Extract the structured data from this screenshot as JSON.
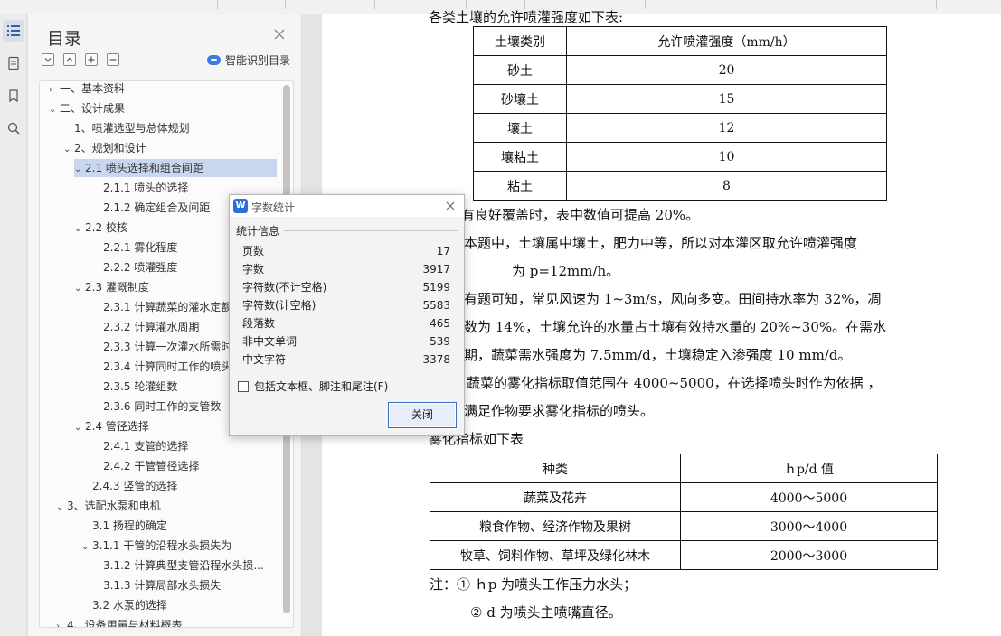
{
  "sidebar": {
    "title": "目录",
    "ai_toc_label": "智能识别目录",
    "items": [
      {
        "label": "一、基本资料",
        "arrow": "›"
      },
      {
        "label": "二、设计成果",
        "arrow": "⌄"
      },
      {
        "label": "1、喷灌选型与总体规划",
        "arrow": ""
      },
      {
        "label": "2、规划和设计",
        "arrow": "⌄"
      },
      {
        "label": "2.1 喷头选择和组合间距",
        "arrow": "⌄"
      },
      {
        "label": "2.1.1 喷头的选择",
        "arrow": ""
      },
      {
        "label": "2.1.2 确定组合及间距",
        "arrow": ""
      },
      {
        "label": "2.2 校核",
        "arrow": "⌄"
      },
      {
        "label": "2.2.1 雾化程度",
        "arrow": ""
      },
      {
        "label": "2.2.2 喷灌强度",
        "arrow": ""
      },
      {
        "label": "2.3 灌溉制度",
        "arrow": "⌄"
      },
      {
        "label": "2.3.1 计算蔬菜的灌水定额",
        "arrow": ""
      },
      {
        "label": "2.3.2 计算灌水周期",
        "arrow": ""
      },
      {
        "label": "2.3.3 计算一次灌水所需时",
        "arrow": ""
      },
      {
        "label": "2.3.4 计算同时工作的喷头",
        "arrow": ""
      },
      {
        "label": "2.3.5 轮灌组数",
        "arrow": ""
      },
      {
        "label": "2.3.6 同时工作的支管数",
        "arrow": ""
      },
      {
        "label": "2.4 管径选择",
        "arrow": "⌄"
      },
      {
        "label": "2.4.1 支管的选择",
        "arrow": ""
      },
      {
        "label": "2.4.2 干管管径选择",
        "arrow": ""
      },
      {
        "label": "2.4.3 竖管的选择",
        "arrow": ""
      },
      {
        "label": "3、选配水泵和电机",
        "arrow": "⌄"
      },
      {
        "label": "3.1 扬程的确定",
        "arrow": ""
      },
      {
        "label": "3.1.1 干管的沿程水头损失为",
        "arrow": "⌄"
      },
      {
        "label": "3.1.2 计算典型支管沿程水头损...",
        "arrow": ""
      },
      {
        "label": "3.1.3 计算局部水头损失",
        "arrow": ""
      },
      {
        "label": "3.2 水泵的选择",
        "arrow": ""
      },
      {
        "label": "4、设备用量与材料概表",
        "arrow": "›"
      }
    ]
  },
  "document": {
    "top_line": "各类土壤的允许喷灌强度如下表:",
    "soil_table": {
      "headers": [
        "土壤类别",
        "允许喷灌强度（mm/h）"
      ],
      "rows": [
        [
          "砂土",
          "20"
        ],
        [
          "砂壤土",
          "15"
        ],
        [
          "壤土",
          "12"
        ],
        [
          "壤粘土",
          "10"
        ],
        [
          "粘土",
          "8"
        ]
      ]
    },
    "p1": "有良好覆盖时，表中数值可提高 20%。",
    "p2a": "本题中，土壤属中壤土，肥力中等，所以对本灌区取允许喷灌强度",
    "p2b": "为 p=12mm/h。",
    "p3a": "有题可知，常见风速为 1~3m/s，风向多变。田间持水率为 32%，凋",
    "p3b": "数为 14%，土壤允许的水量占土壤有效持水量的 20%~30%。在需水",
    "p3c": "期，蔬菜需水强度为 7.5mm/d，土壤稳定入渗强度 10 mm/d。",
    "p4a": "蔬菜的雾化指标取值范围在 4000~5000，在选择喷头时作为依据 ，",
    "p4b": "满足作物要求雾化指标的喷头。",
    "p5": "雾化指标如下表",
    "atom_table": {
      "headers": [
        "种类",
        "ｈp/d 值"
      ],
      "rows": [
        [
          "蔬菜及花卉",
          "4000～5000"
        ],
        [
          "粮食作物、经济作物及果树",
          "3000～4000"
        ],
        [
          "牧草、饲料作物、草坪及绿化林木",
          "2000～3000"
        ]
      ]
    },
    "note1": "注：①  ｈp 为喷头工作压力水头；",
    "note2": "② d 为喷头主喷嘴直径。"
  },
  "dialog": {
    "title": "字数统计",
    "section": "统计信息",
    "stats": [
      {
        "label": "页数",
        "value": "17"
      },
      {
        "label": "字数",
        "value": "3917"
      },
      {
        "label": "字符数(不计空格)",
        "value": "5199"
      },
      {
        "label": "字符数(计空格)",
        "value": "5583"
      },
      {
        "label": "段落数",
        "value": "465"
      },
      {
        "label": "非中文单词",
        "value": "539"
      },
      {
        "label": "中文字符",
        "value": "3378"
      }
    ],
    "checkbox_label": "包括文本框、脚注和尾注(F)",
    "close_label": "关闭"
  },
  "colors": {
    "selected": "#c9d6ef",
    "accent": "#2c6fd8"
  }
}
